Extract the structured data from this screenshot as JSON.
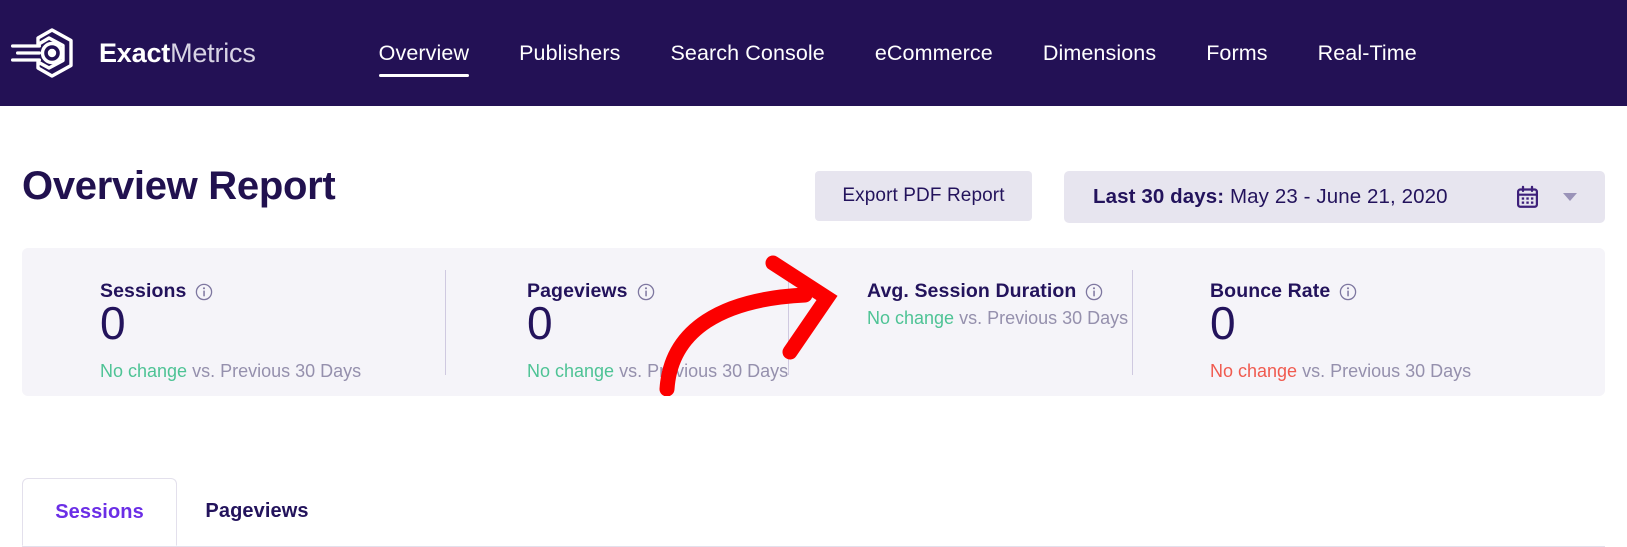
{
  "brand": {
    "name_bold": "Exact",
    "name_light": "Metrics",
    "logo_icon": "exactmetrics-hexagon-logo"
  },
  "nav": {
    "items": [
      {
        "label": "Overview",
        "active": true
      },
      {
        "label": "Publishers",
        "active": false
      },
      {
        "label": "Search Console",
        "active": false
      },
      {
        "label": "eCommerce",
        "active": false
      },
      {
        "label": "Dimensions",
        "active": false
      },
      {
        "label": "Forms",
        "active": false
      },
      {
        "label": "Real-Time",
        "active": false
      }
    ]
  },
  "header": {
    "title": "Overview Report",
    "export_button": "Export PDF Report"
  },
  "date_range": {
    "label": "Last 30 days:",
    "value": " May 23 - June 21, 2020",
    "calendar_icon": "calendar-icon",
    "chevron_icon": "chevron-down-icon"
  },
  "annotation": {
    "arrow_icon": "curved-arrow-annotation",
    "color": "#fc0000",
    "points_to": "Export PDF Report"
  },
  "stats": [
    {
      "label": "Sessions",
      "value": "0",
      "change_word": "No change",
      "change_vs": " vs. Previous 30 Days",
      "change_direction": "up",
      "has_value": true,
      "info_icon": "info-icon"
    },
    {
      "label": "Pageviews",
      "value": "0",
      "change_word": "No change",
      "change_vs": " vs. Previous 30 Days",
      "change_direction": "up",
      "has_value": true,
      "info_icon": "info-icon"
    },
    {
      "label": "Avg. Session Duration",
      "value": "",
      "change_word": "No change",
      "change_vs": " vs. Previous 30 Days",
      "change_direction": "up",
      "has_value": false,
      "info_icon": "info-icon"
    },
    {
      "label": "Bounce Rate",
      "value": "0",
      "change_word": "No change",
      "change_vs": " vs. Previous 30 Days",
      "change_direction": "down",
      "has_value": true,
      "info_icon": "info-icon"
    }
  ],
  "chart_tabs": [
    {
      "label": "Sessions",
      "active": true
    },
    {
      "label": "Pageviews",
      "active": false
    }
  ],
  "colors": {
    "header_bg": "#231155",
    "navy_text": "#23135c",
    "accent_purple": "#6b2ee6",
    "positive_green": "#4ec395",
    "negative_red": "#f05a4f",
    "card_bg": "#f5f4f9",
    "control_bg": "#e7e5ef",
    "annotation_red": "#fc0000"
  }
}
